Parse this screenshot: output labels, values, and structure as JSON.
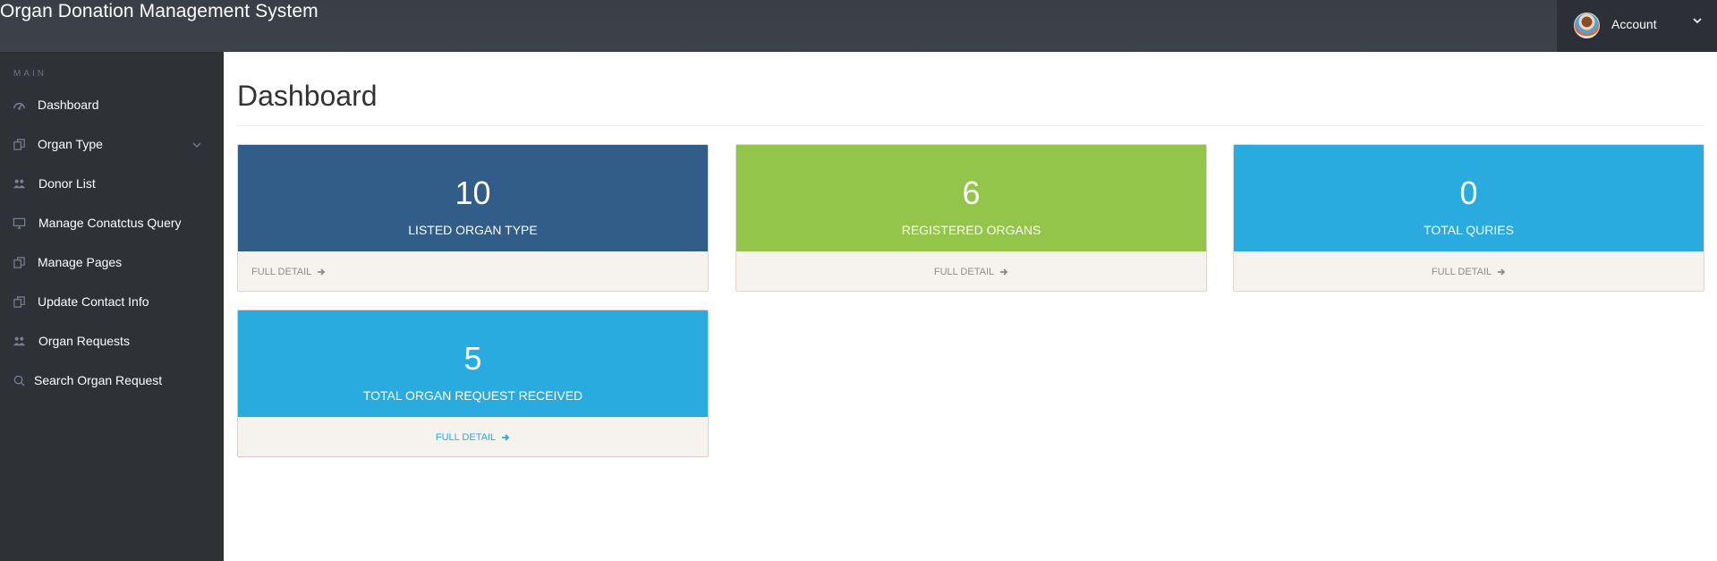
{
  "app": {
    "title": "Organ Donation Management System"
  },
  "account": {
    "label": "Account"
  },
  "sidebar": {
    "section": "MAIN",
    "items": [
      {
        "label": "Dashboard",
        "icon": "dashboard-icon"
      },
      {
        "label": "Organ Type",
        "icon": "copy-icon",
        "expandable": true
      },
      {
        "label": "Donor List",
        "icon": "users-icon"
      },
      {
        "label": "Manage Conatctus Query",
        "icon": "desktop-icon"
      },
      {
        "label": "Manage Pages",
        "icon": "copy-icon"
      },
      {
        "label": "Update Contact Info",
        "icon": "copy-icon"
      },
      {
        "label": "Organ Requests",
        "icon": "users-icon"
      },
      {
        "label": "Search Organ Request",
        "icon": "search-icon"
      }
    ]
  },
  "main": {
    "title": "Dashboard",
    "cards": [
      {
        "value": "10",
        "caption": "LISTED ORGAN TYPE",
        "link": "FULL DETAIL",
        "color": "#325d88",
        "link_color": "#8c8c8c"
      },
      {
        "value": "6",
        "caption": "REGISTERED ORGANS",
        "link": "FULL DETAIL",
        "color": "#93c54b",
        "link_color": "#8c8c8c"
      },
      {
        "value": "0",
        "caption": "TOTAL QURIES",
        "link": "FULL DETAIL",
        "color": "#29abe0",
        "link_color": "#8c8c8c"
      },
      {
        "value": "5",
        "caption": "TOTAL ORGAN REQUEST RECEIVED",
        "link": "FULL DETAIL",
        "color": "#29abe0",
        "link_color": "#29abe0"
      }
    ]
  },
  "colors": {
    "topbar": "#3d424a",
    "sidebar": "#2e3136",
    "account_bg": "#2c3036"
  }
}
